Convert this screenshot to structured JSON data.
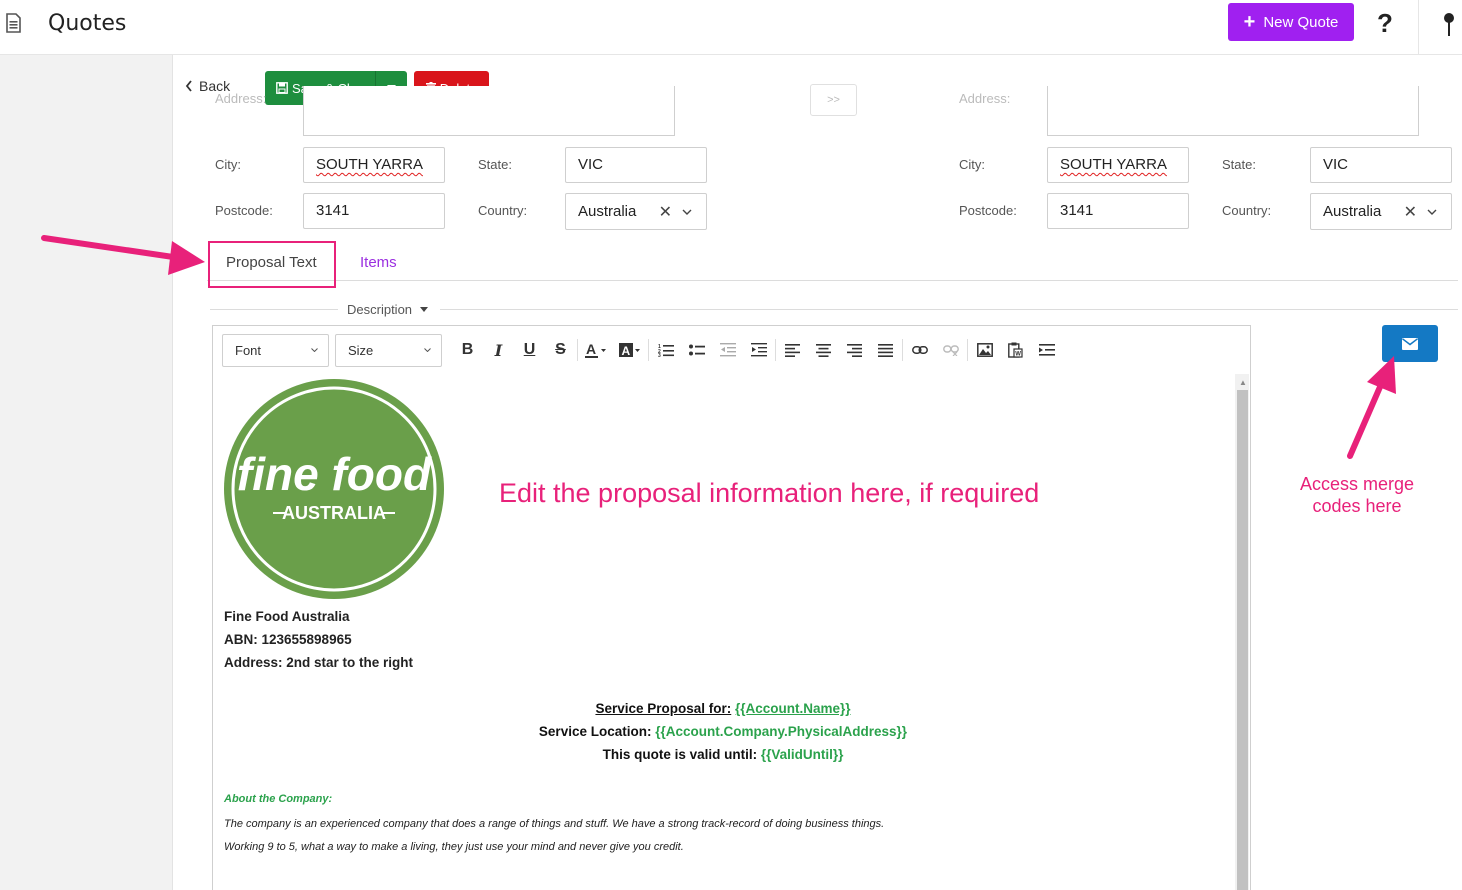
{
  "header": {
    "title": "Quotes",
    "new_quote_label": "New Quote",
    "help_glyph": "?"
  },
  "actions": {
    "back_label": "Back",
    "save_close_label": "Save & Close",
    "delete_label": "Delete"
  },
  "billing": {
    "address_label": "Address:",
    "city_label": "City:",
    "city_value": "SOUTH YARRA",
    "state_label": "State:",
    "state_value": "VIC",
    "postcode_label": "Postcode:",
    "postcode_value": "3141",
    "country_label": "Country:",
    "country_value": "Australia"
  },
  "shipping": {
    "address_label": "Address:",
    "city_label": "City:",
    "city_value": "SOUTH YARRA",
    "state_label": "State:",
    "state_value": "VIC",
    "postcode_label": "Postcode:",
    "postcode_value": "3141",
    "country_label": "Country:",
    "country_value": "Australia"
  },
  "copy_button_label": ">>",
  "tabs": [
    {
      "label": "Proposal Text",
      "active": true
    },
    {
      "label": "Items",
      "active": false
    }
  ],
  "description_label": "Description",
  "editor": {
    "font_label": "Font",
    "size_label": "Size",
    "logo": {
      "line1": "fine food",
      "line2": "AUSTRALIA"
    },
    "company_name": "Fine Food Australia",
    "abn": "ABN: 123655898965",
    "address": "Address: 2nd star to the right",
    "proposal_for_label": "Service Proposal for:",
    "proposal_for_code": "{{Account.Name}}",
    "location_label": "Service Location:",
    "location_code": "{{Account.Company.PhysicalAddress}}",
    "valid_label": "This quote is valid until:",
    "valid_code": "{{ValidUntil}}",
    "about_heading": "About the Company:",
    "about_line1": "The company is an experienced company that does a range of things and stuff. We have a strong track-record of doing business things.",
    "about_line2": "Working 9 to 5, what a way to make a living, they just use your mind and never give you credit."
  },
  "annotations": {
    "edit_note": "Edit the proposal information here, if required",
    "merge_note": "Access merge codes here"
  },
  "colors": {
    "accent_purple": "#a020f0",
    "save_green": "#1e8e3e",
    "delete_red": "#d9151b",
    "merge_blue": "#1479c4",
    "annotation_pink": "#e8217a",
    "merge_code_green": "#2ba24c",
    "logo_green": "#6a9f4a"
  },
  "icons": [
    "document-icon",
    "plus-icon",
    "help-icon",
    "pin-icon",
    "chevron-left-icon",
    "save-icon",
    "trash-icon",
    "caret-down-icon",
    "close-icon",
    "chevron-down-icon",
    "envelope-icon"
  ]
}
